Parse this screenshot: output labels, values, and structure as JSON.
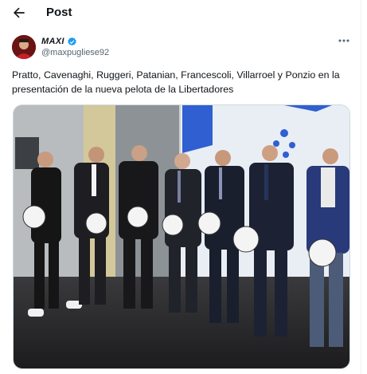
{
  "header": {
    "back_icon": "arrow-left-icon",
    "title": "Post"
  },
  "post": {
    "display_name": "MAXI",
    "handle": "@maxpugliese92",
    "verified_icon": "verified-badge-icon",
    "more_icon": "more-horizontal-icon",
    "text": "Pratto, Cavenaghi, Ruggeri, Patanian, Francescoli, Villarroel y Ponzio en la presentación de la nueva pelota de la Libertadores",
    "media_description_icon": "photo-icon"
  },
  "colors": {
    "text": "#0f1419",
    "secondary": "#536471",
    "verified": "#1d9bf0",
    "border": "#cfd9de",
    "backdrop_blue": "#2f5fd0"
  }
}
